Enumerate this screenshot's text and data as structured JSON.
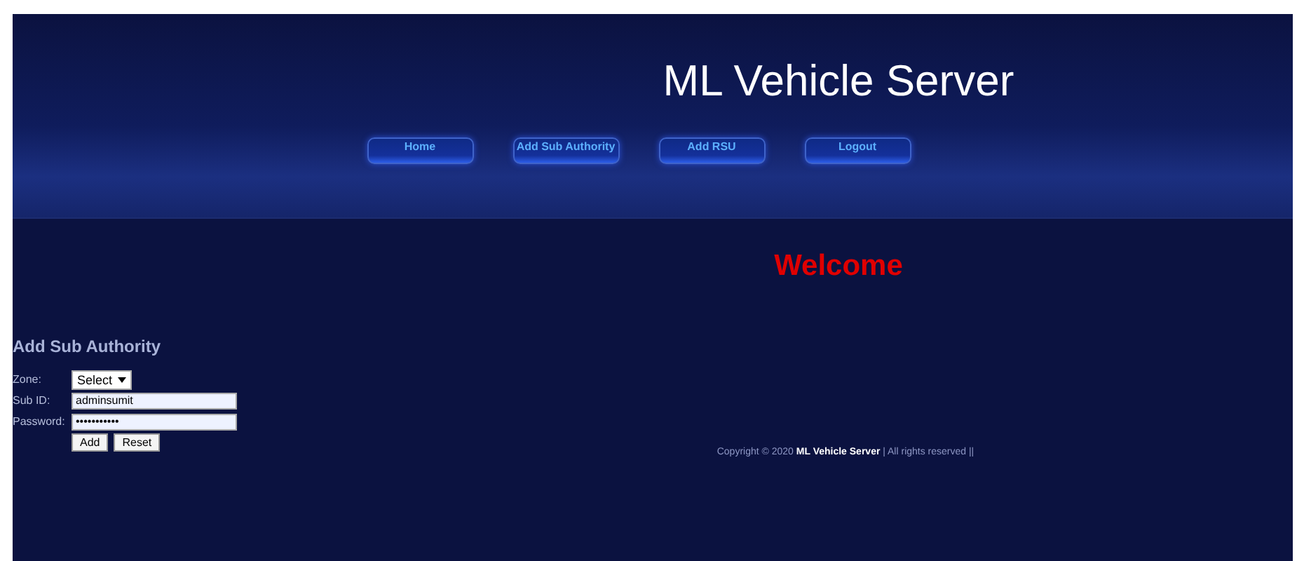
{
  "header": {
    "title": "ML Vehicle Server"
  },
  "nav": [
    {
      "label": "Home"
    },
    {
      "label": "Add Sub Authority"
    },
    {
      "label": "Add RSU"
    },
    {
      "label": "Logout"
    }
  ],
  "welcome": "Welcome",
  "form": {
    "title": "Add Sub Authority",
    "fields": [
      {
        "kind": "select",
        "label": "Zone:",
        "value": "Select"
      },
      {
        "kind": "text",
        "label": "Sub ID:",
        "value": "adminsumit"
      },
      {
        "kind": "text",
        "label": "Password:",
        "value": "•••••••••••"
      }
    ],
    "buttons": [
      "Add",
      "Reset"
    ]
  },
  "footer": "Copyright © 2020 **ML Vehicle Server** | All rights reserved ||"
}
